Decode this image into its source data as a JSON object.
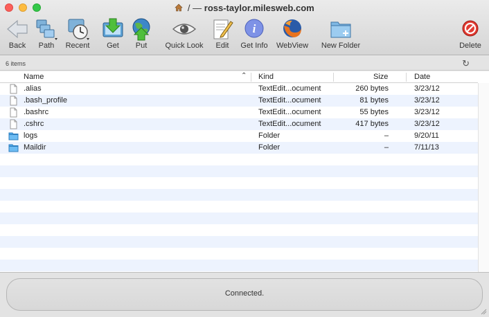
{
  "window": {
    "title_path": "/ —",
    "title_host": "ross-taylor.milesweb.com"
  },
  "toolbar": {
    "back": "Back",
    "path": "Path",
    "recent": "Recent",
    "get": "Get",
    "put": "Put",
    "quick_look": "Quick Look",
    "edit": "Edit",
    "get_info": "Get Info",
    "webview": "WebView",
    "new_folder": "New Folder",
    "delete": "Delete"
  },
  "infobar": {
    "item_count": "6 items"
  },
  "table": {
    "columns": {
      "name": "Name",
      "kind": "Kind",
      "size": "Size",
      "date": "Date"
    },
    "rows": [
      {
        "type": "file",
        "name": ".alias",
        "kind": "TextEdit...ocument",
        "size": "260 bytes",
        "date": "3/23/12"
      },
      {
        "type": "file",
        "name": ".bash_profile",
        "kind": "TextEdit...ocument",
        "size": "81 bytes",
        "date": "3/23/12"
      },
      {
        "type": "file",
        "name": ".bashrc",
        "kind": "TextEdit...ocument",
        "size": "55 bytes",
        "date": "3/23/12"
      },
      {
        "type": "file",
        "name": ".cshrc",
        "kind": "TextEdit...ocument",
        "size": "417 bytes",
        "date": "3/23/12"
      },
      {
        "type": "folder",
        "name": "logs",
        "kind": "Folder",
        "size": "–",
        "date": "9/20/11"
      },
      {
        "type": "folder",
        "name": "Maildir",
        "kind": "Folder",
        "size": "–",
        "date": "7/11/13"
      }
    ]
  },
  "status": {
    "text": "Connected."
  },
  "colors": {
    "folder": "#5ab4ef",
    "stripe": "#edf3fe"
  }
}
